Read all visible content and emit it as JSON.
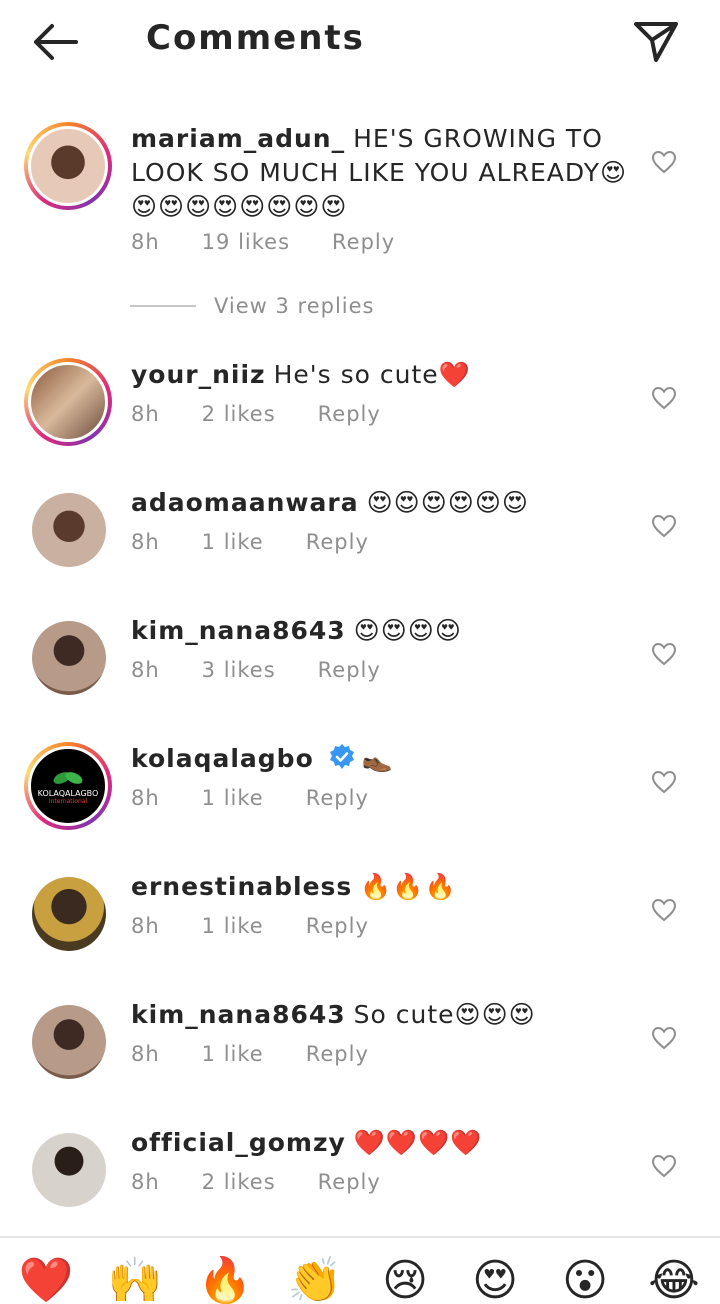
{
  "header": {
    "title": "Comments"
  },
  "comments": [
    {
      "username": "mariam_adun_",
      "text": "HE'S GROWING TO LOOK SO MUCH LIKE YOU ALREADY😍😍😍😍😍😍😍😍😍",
      "time": "8h",
      "likes": "19 likes",
      "reply": "Reply"
    },
    {
      "username": "your_niiz",
      "text": "He's so cute❤️",
      "time": "8h",
      "likes": "2 likes",
      "reply": "Reply"
    },
    {
      "username": "adaomaanwara",
      "text": "😍😍😍😍😍😍",
      "time": "8h",
      "likes": "1 like",
      "reply": "Reply"
    },
    {
      "username": "kim_nana8643",
      "text": "😍😍😍😍",
      "time": "8h",
      "likes": "3 likes",
      "reply": "Reply"
    },
    {
      "username": "kolaqalagbo",
      "text": "👞",
      "time": "8h",
      "likes": "1 like",
      "reply": "Reply",
      "avatar_text": "KOLAQALAGBO",
      "avatar_subtext": "International"
    },
    {
      "username": "ernestinabless",
      "text": "🔥🔥🔥",
      "time": "8h",
      "likes": "1 like",
      "reply": "Reply"
    },
    {
      "username": "kim_nana8643",
      "text": "So cute😍😍😍",
      "time": "8h",
      "likes": "1 like",
      "reply": "Reply"
    },
    {
      "username": "official_gomzy",
      "text": "❤️❤️❤️❤️",
      "time": "8h",
      "likes": "2 likes",
      "reply": "Reply"
    }
  ],
  "view_replies": "View 3 replies",
  "emoji_bar": [
    "❤️",
    "🙌",
    "🔥",
    "👏",
    "😢",
    "😍",
    "😮",
    "😂"
  ],
  "colors": {
    "text": "#262626",
    "secondary": "#8e8e8e",
    "verified": "#3897f0"
  }
}
